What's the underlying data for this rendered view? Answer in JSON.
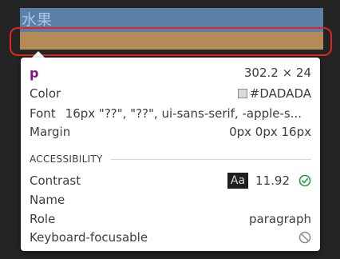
{
  "page": {
    "top_text": "水果",
    "background_snippet": "..."
  },
  "tooltip": {
    "tag": "p",
    "size": "302.2 × 24",
    "color_label": "Color",
    "color_value": "#DADADA",
    "font_label": "Font",
    "font_value": "16px \"??\", \"??\", ui-sans-serif, -apple-s...",
    "margin_label": "Margin",
    "margin_value": "0px 0px 16px",
    "accessibility_heading": "ACCESSIBILITY",
    "contrast_label": "Contrast",
    "contrast_sample": "Aa",
    "contrast_ratio": "11.92",
    "name_label": "Name",
    "role_label": "Role",
    "role_value": "paragraph",
    "keyboard_label": "Keyboard-focusable"
  },
  "colors": {
    "element_color": "#DADADA",
    "content_box": "#5a7fa8",
    "margin_box": "#b48a56",
    "highlight_ring": "#e1241c",
    "pass_icon": "#1e9e3c"
  },
  "icons": {
    "contrast_status": "check-circle-icon",
    "keyboard_status": "no-entry-icon"
  }
}
